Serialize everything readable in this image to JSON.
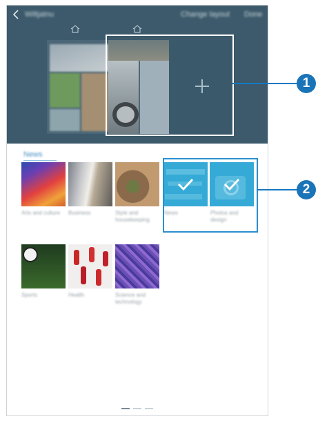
{
  "header": {
    "title": "Wiltjatnu",
    "change_layout_label": "Change layout",
    "done_label": "Done"
  },
  "section": {
    "title": "News"
  },
  "categories": [
    {
      "label": "Arts and culture"
    },
    {
      "label": "Business"
    },
    {
      "label": "Style and housekeeping"
    },
    {
      "label": "News"
    },
    {
      "label": "Photos and design"
    },
    {
      "label": "Sports"
    },
    {
      "label": "Health"
    },
    {
      "label": "Science and technology"
    }
  ],
  "callouts": [
    "1",
    "2"
  ],
  "colors": {
    "panel": "#3c5a6b",
    "accent": "#2a8fd0",
    "selected_tile": "#2fa8d6",
    "callout": "#1a74b8"
  }
}
